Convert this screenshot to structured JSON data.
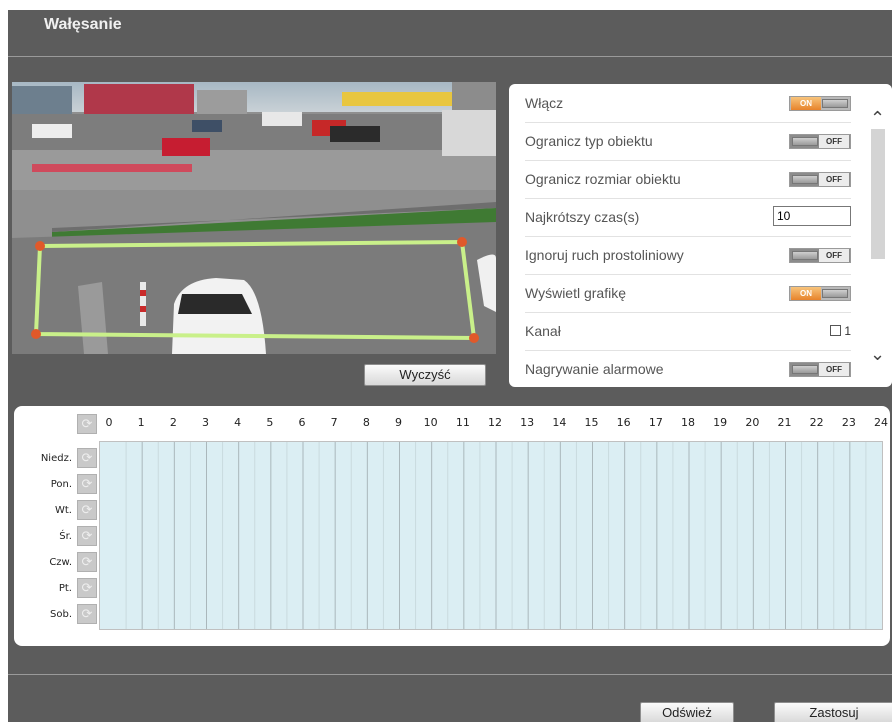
{
  "header": {
    "title": "Wałęsanie"
  },
  "video": {
    "clear_label": "Wyczyść",
    "zone_color": "#c9f08a",
    "handle_color": "#e0592a"
  },
  "settings": {
    "rows": [
      {
        "label": "Włącz",
        "control": "toggle",
        "state": "on",
        "toggle_text": "ON"
      },
      {
        "label": "Ogranicz typ obiektu",
        "control": "toggle",
        "state": "off",
        "toggle_text": "OFF"
      },
      {
        "label": "Ogranicz rozmiar obiektu",
        "control": "toggle",
        "state": "off",
        "toggle_text": "OFF"
      },
      {
        "label": "Najkrótszy czas(s)",
        "control": "input",
        "value": "10"
      },
      {
        "label": "Ignoruj ruch prostoliniowy",
        "control": "toggle",
        "state": "off",
        "toggle_text": "OFF"
      },
      {
        "label": "Wyświetl grafikę",
        "control": "toggle",
        "state": "on",
        "toggle_text": "ON"
      },
      {
        "label": "Kanał",
        "control": "checkbox",
        "checked": false,
        "checkbox_label": "1"
      },
      {
        "label": "Nagrywanie alarmowe",
        "control": "toggle",
        "state": "off",
        "toggle_text": "OFF"
      }
    ],
    "scroll_up_icon": "chevron-up-icon",
    "scroll_down_icon": "chevron-down-icon"
  },
  "schedule": {
    "hours": [
      "0",
      "1",
      "2",
      "3",
      "4",
      "5",
      "6",
      "7",
      "8",
      "9",
      "10",
      "11",
      "12",
      "13",
      "14",
      "15",
      "16",
      "17",
      "18",
      "19",
      "20",
      "21",
      "22",
      "23",
      "24"
    ],
    "days": [
      "Niedz.",
      "Pon.",
      "Wt.",
      "Śr.",
      "Czw.",
      "Pt.",
      "Sob."
    ],
    "copy_icon": "copy-icon",
    "grid_color": "#dbeef3"
  },
  "footer": {
    "refresh_label": "Odśwież",
    "apply_label": "Zastosuj"
  }
}
